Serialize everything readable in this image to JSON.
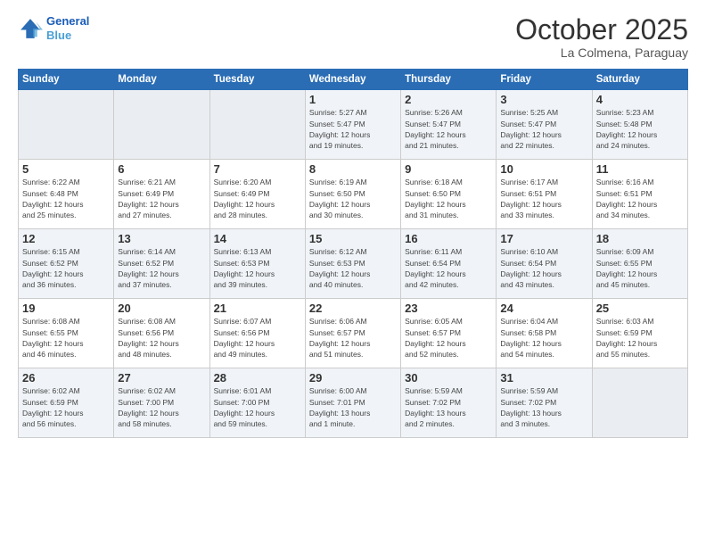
{
  "header": {
    "logo_line1": "General",
    "logo_line2": "Blue",
    "month": "October 2025",
    "location": "La Colmena, Paraguay"
  },
  "weekdays": [
    "Sunday",
    "Monday",
    "Tuesday",
    "Wednesday",
    "Thursday",
    "Friday",
    "Saturday"
  ],
  "weeks": [
    [
      {
        "day": "",
        "info": ""
      },
      {
        "day": "",
        "info": ""
      },
      {
        "day": "",
        "info": ""
      },
      {
        "day": "1",
        "info": "Sunrise: 5:27 AM\nSunset: 5:47 PM\nDaylight: 12 hours\nand 19 minutes."
      },
      {
        "day": "2",
        "info": "Sunrise: 5:26 AM\nSunset: 5:47 PM\nDaylight: 12 hours\nand 21 minutes."
      },
      {
        "day": "3",
        "info": "Sunrise: 5:25 AM\nSunset: 5:47 PM\nDaylight: 12 hours\nand 22 minutes."
      },
      {
        "day": "4",
        "info": "Sunrise: 5:23 AM\nSunset: 5:48 PM\nDaylight: 12 hours\nand 24 minutes."
      }
    ],
    [
      {
        "day": "5",
        "info": "Sunrise: 6:22 AM\nSunset: 6:48 PM\nDaylight: 12 hours\nand 25 minutes."
      },
      {
        "day": "6",
        "info": "Sunrise: 6:21 AM\nSunset: 6:49 PM\nDaylight: 12 hours\nand 27 minutes."
      },
      {
        "day": "7",
        "info": "Sunrise: 6:20 AM\nSunset: 6:49 PM\nDaylight: 12 hours\nand 28 minutes."
      },
      {
        "day": "8",
        "info": "Sunrise: 6:19 AM\nSunset: 6:50 PM\nDaylight: 12 hours\nand 30 minutes."
      },
      {
        "day": "9",
        "info": "Sunrise: 6:18 AM\nSunset: 6:50 PM\nDaylight: 12 hours\nand 31 minutes."
      },
      {
        "day": "10",
        "info": "Sunrise: 6:17 AM\nSunset: 6:51 PM\nDaylight: 12 hours\nand 33 minutes."
      },
      {
        "day": "11",
        "info": "Sunrise: 6:16 AM\nSunset: 6:51 PM\nDaylight: 12 hours\nand 34 minutes."
      }
    ],
    [
      {
        "day": "12",
        "info": "Sunrise: 6:15 AM\nSunset: 6:52 PM\nDaylight: 12 hours\nand 36 minutes."
      },
      {
        "day": "13",
        "info": "Sunrise: 6:14 AM\nSunset: 6:52 PM\nDaylight: 12 hours\nand 37 minutes."
      },
      {
        "day": "14",
        "info": "Sunrise: 6:13 AM\nSunset: 6:53 PM\nDaylight: 12 hours\nand 39 minutes."
      },
      {
        "day": "15",
        "info": "Sunrise: 6:12 AM\nSunset: 6:53 PM\nDaylight: 12 hours\nand 40 minutes."
      },
      {
        "day": "16",
        "info": "Sunrise: 6:11 AM\nSunset: 6:54 PM\nDaylight: 12 hours\nand 42 minutes."
      },
      {
        "day": "17",
        "info": "Sunrise: 6:10 AM\nSunset: 6:54 PM\nDaylight: 12 hours\nand 43 minutes."
      },
      {
        "day": "18",
        "info": "Sunrise: 6:09 AM\nSunset: 6:55 PM\nDaylight: 12 hours\nand 45 minutes."
      }
    ],
    [
      {
        "day": "19",
        "info": "Sunrise: 6:08 AM\nSunset: 6:55 PM\nDaylight: 12 hours\nand 46 minutes."
      },
      {
        "day": "20",
        "info": "Sunrise: 6:08 AM\nSunset: 6:56 PM\nDaylight: 12 hours\nand 48 minutes."
      },
      {
        "day": "21",
        "info": "Sunrise: 6:07 AM\nSunset: 6:56 PM\nDaylight: 12 hours\nand 49 minutes."
      },
      {
        "day": "22",
        "info": "Sunrise: 6:06 AM\nSunset: 6:57 PM\nDaylight: 12 hours\nand 51 minutes."
      },
      {
        "day": "23",
        "info": "Sunrise: 6:05 AM\nSunset: 6:57 PM\nDaylight: 12 hours\nand 52 minutes."
      },
      {
        "day": "24",
        "info": "Sunrise: 6:04 AM\nSunset: 6:58 PM\nDaylight: 12 hours\nand 54 minutes."
      },
      {
        "day": "25",
        "info": "Sunrise: 6:03 AM\nSunset: 6:59 PM\nDaylight: 12 hours\nand 55 minutes."
      }
    ],
    [
      {
        "day": "26",
        "info": "Sunrise: 6:02 AM\nSunset: 6:59 PM\nDaylight: 12 hours\nand 56 minutes."
      },
      {
        "day": "27",
        "info": "Sunrise: 6:02 AM\nSunset: 7:00 PM\nDaylight: 12 hours\nand 58 minutes."
      },
      {
        "day": "28",
        "info": "Sunrise: 6:01 AM\nSunset: 7:00 PM\nDaylight: 12 hours\nand 59 minutes."
      },
      {
        "day": "29",
        "info": "Sunrise: 6:00 AM\nSunset: 7:01 PM\nDaylight: 13 hours\nand 1 minute."
      },
      {
        "day": "30",
        "info": "Sunrise: 5:59 AM\nSunset: 7:02 PM\nDaylight: 13 hours\nand 2 minutes."
      },
      {
        "day": "31",
        "info": "Sunrise: 5:59 AM\nSunset: 7:02 PM\nDaylight: 13 hours\nand 3 minutes."
      },
      {
        "day": "",
        "info": ""
      }
    ]
  ]
}
